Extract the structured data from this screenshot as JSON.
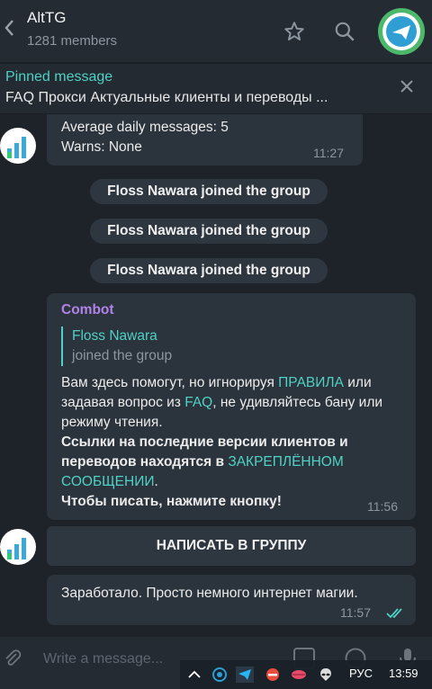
{
  "header": {
    "title": "AltTG",
    "members": "1281 members"
  },
  "pinned": {
    "label": "Pinned message",
    "text": "FAQ   Прокси   Актуальные клиенты и переводы  ..."
  },
  "messages": {
    "stats": {
      "line1": "Average daily messages: 5",
      "line2": "Warns: None",
      "time": "11:27"
    },
    "service": [
      "Floss Nawara joined the group",
      "Floss Nawara joined the group",
      "Floss Nawara joined the group"
    ],
    "combot": {
      "sender": "Combot",
      "quote_name": "Floss Nawara",
      "quote_text": "joined the group",
      "p1_a": "Вам здесь помогут, но игнорируя ",
      "p1_link1": "ПРАВИЛА",
      "p1_b": " или задавая вопрос из ",
      "p1_link2": "FAQ",
      "p1_c": ", не удивляйтесь бану или режиму чтения.",
      "p2_a": "Ссылки на последние версии клиентов и переводов находятся в ",
      "p2_link": "ЗАКРЕПЛЁННОМ СООБЩЕНИИ",
      "p2_b": ".",
      "p3": "Чтобы писать, нажмите кнопку!",
      "time": "11:56"
    },
    "button_label": "НАПИСАТЬ В ГРУППУ",
    "own": {
      "text": "Заработало. Просто немного интернет магии.",
      "time": "11:57"
    }
  },
  "composer": {
    "placeholder": "Write a message..."
  },
  "taskbar": {
    "language": "РУС",
    "clock": "13:59"
  },
  "colors": {
    "accent": "#4fd1c5",
    "sender": "#b184e8",
    "background": "#1e2329",
    "bubble": "#2b333c"
  }
}
